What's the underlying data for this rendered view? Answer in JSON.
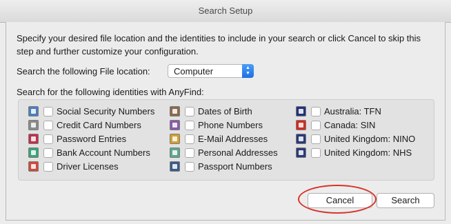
{
  "window": {
    "title": "Search Setup"
  },
  "intro": "Specify your desired file location and the identities to include in your search or click Cancel to skip this step and further customize your configuration.",
  "location": {
    "label": "Search the following File location:",
    "selected": "Computer",
    "arrow_up": "▲",
    "arrow_down": "▼"
  },
  "identities": {
    "label": "Search for the following identities with AnyFind:",
    "columns": [
      [
        {
          "label": "Social Security Numbers",
          "icon": "id-card-icon",
          "color": "#4a7fbf",
          "checked": false
        },
        {
          "label": "Credit Card Numbers",
          "icon": "credit-card-icon",
          "color": "#8a8a8a",
          "checked": false
        },
        {
          "label": "Password Entries",
          "icon": "password-icon",
          "color": "#c0304a",
          "checked": false
        },
        {
          "label": "Bank Account Numbers",
          "icon": "bank-icon",
          "color": "#3aa37a",
          "checked": false
        },
        {
          "label": "Driver Licenses",
          "icon": "driver-license-icon",
          "color": "#d04a3a",
          "checked": false
        }
      ],
      [
        {
          "label": "Dates of Birth",
          "icon": "calendar-icon",
          "color": "#8a6a4a",
          "checked": false
        },
        {
          "label": "Phone Numbers",
          "icon": "phone-icon",
          "color": "#8a5aa8",
          "checked": false
        },
        {
          "label": "E-Mail Addresses",
          "icon": "email-icon",
          "color": "#d4a030",
          "checked": false
        },
        {
          "label": "Personal Addresses",
          "icon": "address-icon",
          "color": "#5aa890",
          "checked": false
        },
        {
          "label": "Passport Numbers",
          "icon": "passport-icon",
          "color": "#3a5a8a",
          "checked": false
        }
      ],
      [
        {
          "label": "Australia: TFN",
          "icon": "australia-flag-icon",
          "color": "#22337a",
          "checked": false
        },
        {
          "label": "Canada: SIN",
          "icon": "canada-flag-icon",
          "color": "#d52b1e",
          "checked": false
        },
        {
          "label": "United Kingdom: NINO",
          "icon": "uk-flag-icon",
          "color": "#2a3a7a",
          "checked": false
        },
        {
          "label": "United Kingdom: NHS",
          "icon": "uk-flag-icon",
          "color": "#2a3a7a",
          "checked": false
        }
      ]
    ]
  },
  "buttons": {
    "cancel": "Cancel",
    "search": "Search"
  },
  "annotation_color": "#d7332a"
}
